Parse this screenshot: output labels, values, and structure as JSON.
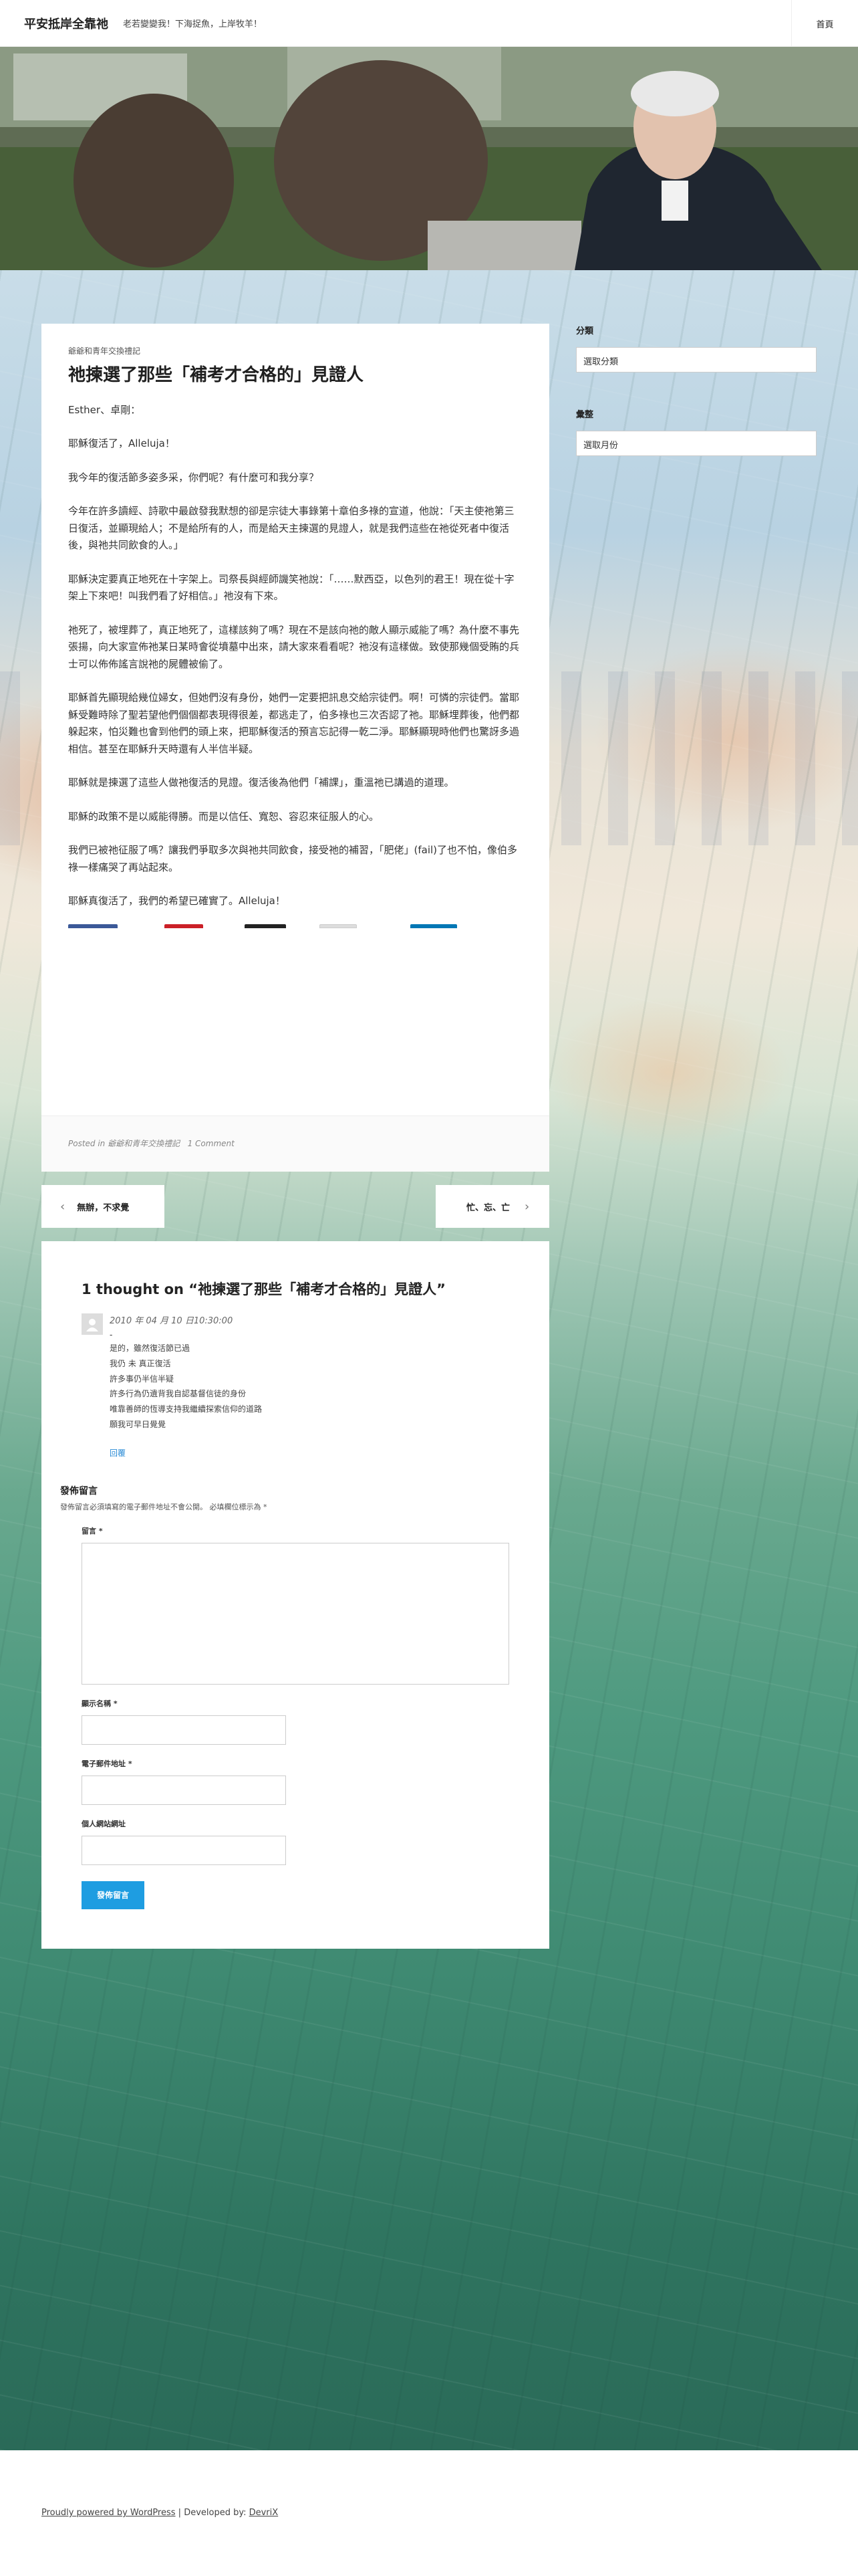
{
  "header": {
    "site_title": "平安抵岸全靠祂",
    "site_description": "老若變變我！下海捉魚，上岸牧羊！",
    "nav_home": "首頁"
  },
  "post": {
    "category": "爺爺和青年交換禮記",
    "title": "祂揀選了那些「補考才合格的」見證人",
    "paragraphs": [
      "Esther、卓剛：",
      "耶穌復活了，Alleluja！",
      "我今年的復活節多姿多采，你們呢？有什麼可和我分享？",
      "今年在許多讀經、詩歌中最啟發我默想的卻是宗徒大事錄第十章伯多祿的宣道，他說：「天主使祂第三日復活，並顯現給人；不是給所有的人，而是給天主揀選的見證人，就是我們這些在祂從死者中復活後，與祂共同飲食的人。」",
      "耶穌決定要真正地死在十字架上。司祭長與經師譏笑祂說：「……默西亞，以色列的君王！現在從十字架上下來吧！叫我們看了好相信。」祂沒有下來。",
      "祂死了，被埋葬了，真正地死了，這樣該夠了嗎？現在不是該向祂的敵人顯示威能了嗎？為什麼不事先張揚，向大家宣佈祂某日某時會從墳墓中出來，請大家來看看呢？祂沒有這樣做。致使那幾個受賄的兵士可以佈佈謠言說祂的屍體被偷了。",
      "耶穌首先顯現給幾位婦女，但她們沒有身份，她們一定要把訊息交給宗徒們。啊！可憐的宗徒們。當耶穌受難時除了聖若望他們個個都表現得很差，都逃走了，伯多祿也三次否認了祂。耶穌埋葬後，他們都躲起來，怕災難也會到他們的頭上來，把耶穌復活的預言忘記得一乾二淨。耶穌顯現時他們也驚訝多過相信。甚至在耶穌升天時還有人半信半疑。",
      "耶穌就是揀選了這些人做祂復活的見證。復活後為他們「補課」，重溫祂已講過的道理。",
      "耶穌的政策不是以威能得勝。而是以信任、寬恕、容忍來征服人的心。",
      "我們已被祂征服了嗎？讓我們爭取多次與祂共同飲食，接受祂的補習，「肥佬」(fail)了也不怕，像伯多祿一樣痛哭了再站起來。",
      "耶穌真復活了，我們的希望已確實了。Alleluja！"
    ],
    "footer_prefix": "Posted in",
    "footer_category": "爺爺和青年交換禮記",
    "footer_comments": "1 Comment"
  },
  "post_nav": {
    "prev_label": "無辦，不求覺",
    "next_label": "忙、忘、亡"
  },
  "comments": {
    "title": "1 thought on “祂揀選了那些「補考才合格的」見證人”",
    "items": [
      {
        "date": "2010 年 04 月 10 日10:30:00",
        "author": "-",
        "lines": [
          "是的，雖然復活節已過",
          "我仍 未 真正復活",
          "許多事仍半信半疑",
          "許多行為仍遺背我自認基督信徒的身份",
          "唯靠善師的恆導支持我繼續探索信仰的道路",
          "願我可早日覺覺"
        ],
        "reply": "回覆"
      }
    ],
    "respond_title": "發佈留言",
    "respond_note": "發佈留言必須填寫的電子郵件地址不會公開。 必填欄位標示為 *",
    "comment_label": "留言 *",
    "name_label": "顯示名稱 *",
    "email_label": "電子郵件地址 *",
    "website_label": "個人網站網址",
    "submit_label": "發佈留言"
  },
  "sidebar": {
    "categories_title": "分類",
    "categories_select": "選取分類",
    "archives_title": "彙整",
    "archives_select": "選取月份"
  },
  "footer": {
    "powered": "Proudly powered by WordPress",
    "separator": " | Developed by: ",
    "developer": "DevriX"
  },
  "colors": {
    "accent": "#1e9de1",
    "share_facebook": "#3b5998",
    "share_pinterest": "#cb2027",
    "share_x": "#222222",
    "share_email": "#dddddd",
    "share_linkedin": "#0077b5"
  }
}
